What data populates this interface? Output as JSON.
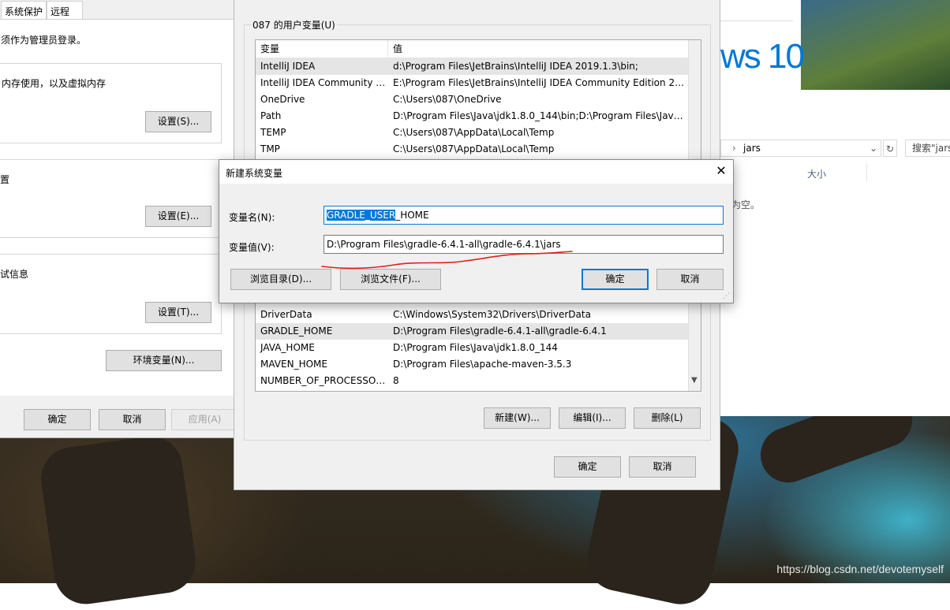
{
  "system_props": {
    "tabs": [
      "系统保护",
      "远程"
    ],
    "admin_note": "须作为管理员登录。",
    "performance_desc": "内存使用，以及虚拟内存",
    "settings1": "设置(S)...",
    "profiles_title": "置",
    "settings2": "设置(E)...",
    "startup_title": "试信息",
    "settings3": "设置(T)...",
    "env_button": "环境变量(N)...",
    "ok": "确定",
    "cancel": "取消",
    "apply": "应用(A)"
  },
  "explorer": {
    "brand_text": "ws 10",
    "breadcrumb": "jars",
    "search_placeholder": "搜索\"jars",
    "size_header": "大小",
    "empty_text": "为空。"
  },
  "env_dialog": {
    "user_vars_title": "087 的用户变量(U)",
    "col_var": "变量",
    "col_val": "值",
    "user_vars": [
      {
        "name": "IntelliJ IDEA",
        "value": "d:\\Program Files\\JetBrains\\IntelliJ IDEA 2019.1.3\\bin;"
      },
      {
        "name": "IntelliJ IDEA Community E...",
        "value": "E:\\Program Files\\JetBrains\\IntelliJ IDEA Community Edition 20..."
      },
      {
        "name": "OneDrive",
        "value": "C:\\Users\\087\\OneDrive"
      },
      {
        "name": "Path",
        "value": "D:\\Program Files\\Java\\jdk1.8.0_144\\bin;D:\\Program Files\\Java..."
      },
      {
        "name": "TEMP",
        "value": "C:\\Users\\087\\AppData\\Local\\Temp"
      },
      {
        "name": "TMP",
        "value": "C:\\Users\\087\\AppData\\Local\\Temp"
      }
    ],
    "system_vars": [
      {
        "name": "DriverData",
        "value": "C:\\Windows\\System32\\Drivers\\DriverData"
      },
      {
        "name": "GRADLE_HOME",
        "value": "D:\\Program Files\\gradle-6.4.1-all\\gradle-6.4.1"
      },
      {
        "name": "JAVA_HOME",
        "value": "D:\\Program Files\\Java\\jdk1.8.0_144"
      },
      {
        "name": "MAVEN_HOME",
        "value": "D:\\Program Files\\apache-maven-3.5.3"
      },
      {
        "name": "NUMBER_OF_PROCESSORS",
        "value": "8"
      }
    ],
    "new_btn": "新建(W)...",
    "edit_btn": "编辑(I)...",
    "delete_btn": "删除(L)",
    "ok": "确定",
    "cancel": "取消"
  },
  "new_var_dialog": {
    "title": "新建系统变量",
    "name_label": "变量名(N):",
    "value_label": "变量值(V):",
    "name_selected": "GRADLE_USER",
    "name_rest": "_HOME",
    "value": "D:\\Program Files\\gradle-6.4.1-all\\gradle-6.4.1\\jars",
    "browse_dir": "浏览目录(D)...",
    "browse_file": "浏览文件(F)...",
    "ok": "确定",
    "cancel": "取消",
    "close_glyph": "✕"
  },
  "watermark": "https://blog.csdn.net/devotemyself",
  "colors": {
    "accent": "#0078d7",
    "annotation": "#e0201a"
  }
}
